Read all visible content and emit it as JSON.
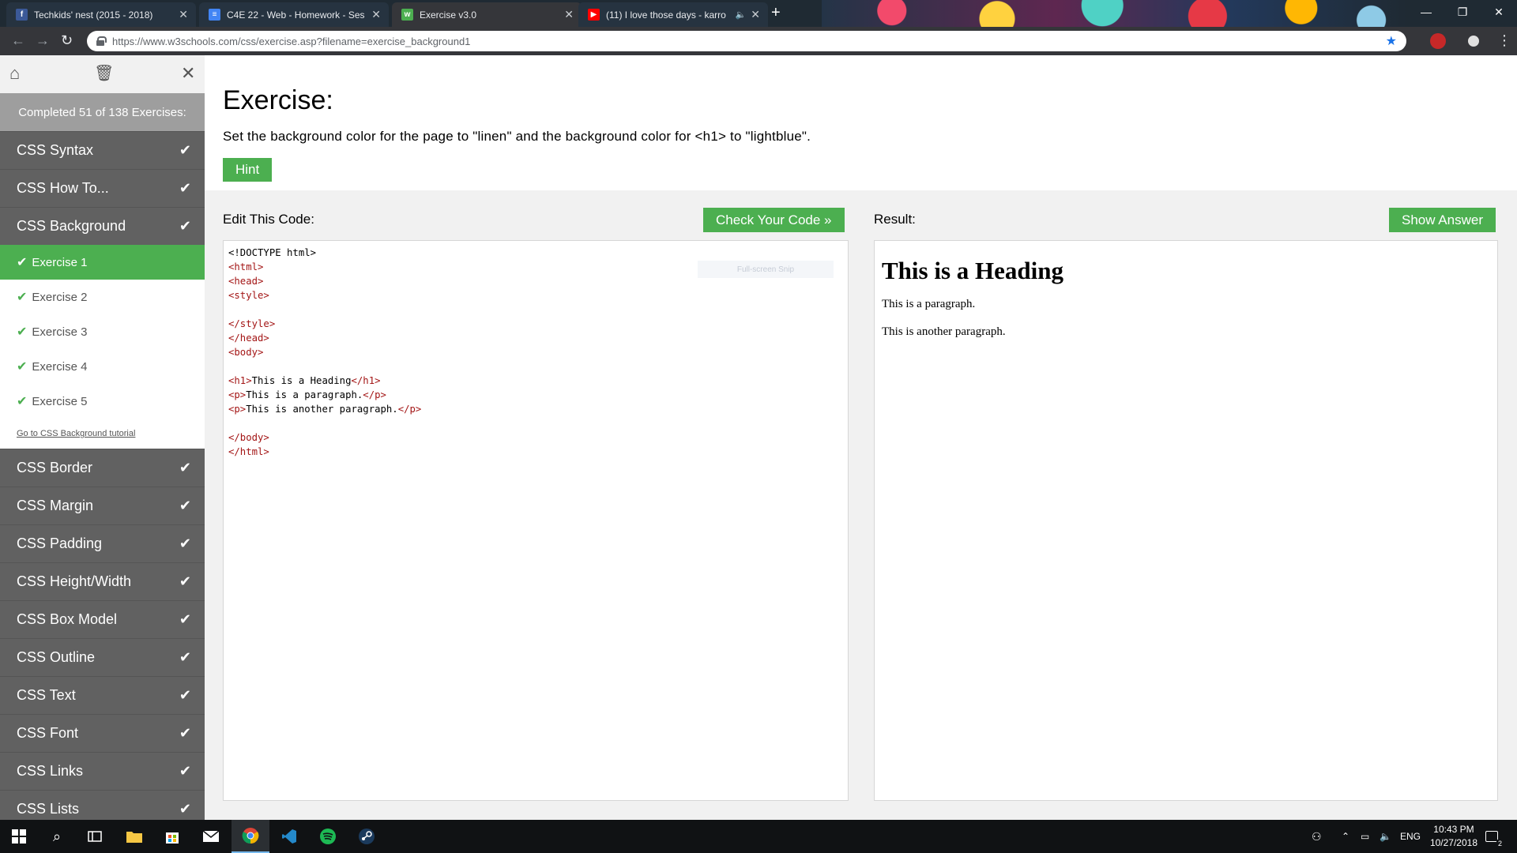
{
  "browser": {
    "tabs": [
      {
        "title": "Techkids' nest (2015 - 2018)",
        "favicon": "facebook-icon",
        "color": "#3b5998"
      },
      {
        "title": "C4E 22 - Web - Homework - Ses",
        "favicon": "docs-icon",
        "color": "#4285f4"
      },
      {
        "title": "Exercise v3.0",
        "favicon": "w3schools-icon",
        "color": "#4caf50"
      },
      {
        "title": "(11) I love those days - karro",
        "favicon": "youtube-icon",
        "color": "#ff0000"
      }
    ],
    "url": "https://www.w3schools.com/css/exercise.asp?filename=exercise_background1"
  },
  "sidebar": {
    "progress": "Completed 51 of 138 Exercises:",
    "items_before": [
      {
        "label": "CSS Syntax"
      },
      {
        "label": "CSS How To..."
      },
      {
        "label": "CSS Background"
      }
    ],
    "exercises": [
      {
        "label": "Exercise 1"
      },
      {
        "label": "Exercise 2"
      },
      {
        "label": "Exercise 3"
      },
      {
        "label": "Exercise 4"
      },
      {
        "label": "Exercise 5"
      }
    ],
    "tutorial_link": "Go to CSS Background tutorial",
    "items_after": [
      {
        "label": "CSS Border"
      },
      {
        "label": "CSS Margin"
      },
      {
        "label": "CSS Padding"
      },
      {
        "label": "CSS Height/Width"
      },
      {
        "label": "CSS Box Model"
      },
      {
        "label": "CSS Outline"
      },
      {
        "label": "CSS Text"
      },
      {
        "label": "CSS Font"
      },
      {
        "label": "CSS Links"
      },
      {
        "label": "CSS Lists"
      }
    ]
  },
  "exercise": {
    "title": "Exercise:",
    "instruction": "Set the background color for the page to \"linen\" and the background color for <h1> to \"lightblue\".",
    "hint_label": "Hint",
    "edit_label": "Edit This Code:",
    "check_label": "Check Your Code »",
    "result_label": "Result:",
    "answer_label": "Show Answer",
    "snip_overlay": "Full-screen Snip",
    "code_lines": [
      "<!DOCTYPE html>",
      "<html>",
      "<head>",
      "<style>",
      "",
      "</style>",
      "</head>",
      "<body>",
      "",
      "<h1>This is a Heading</h1>",
      "<p>This is a paragraph.</p>",
      "<p>This is another paragraph.</p>",
      "",
      "</body>",
      "</html>"
    ]
  },
  "result": {
    "heading": "This is a Heading",
    "paragraph1": "This is a paragraph.",
    "paragraph2": "This is another paragraph."
  },
  "taskbar": {
    "language": "ENG",
    "time": "10:43 PM",
    "date": "10/27/2018",
    "notifications": "2"
  },
  "colors": {
    "accent": "#4caf50",
    "sidebar": "#616161",
    "code_tag": "#a31515"
  }
}
